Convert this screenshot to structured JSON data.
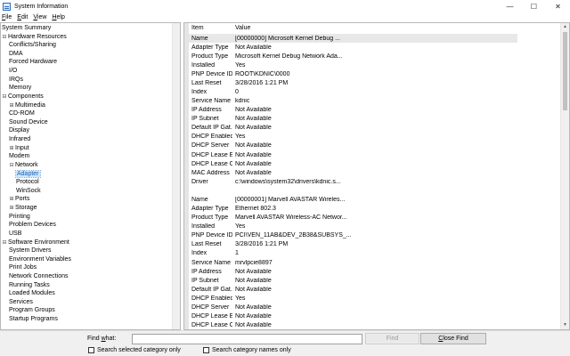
{
  "window": {
    "title": "System Information"
  },
  "controls": {
    "minimize": "—",
    "maximize": "☐",
    "close": "✕"
  },
  "menu": [
    {
      "label_pre": "",
      "label_u": "F",
      "label_post": "ile"
    },
    {
      "label_pre": "",
      "label_u": "E",
      "label_post": "dit"
    },
    {
      "label_pre": "",
      "label_u": "V",
      "label_post": "iew"
    },
    {
      "label_pre": "",
      "label_u": "H",
      "label_post": "elp"
    }
  ],
  "tree": [
    {
      "label": "System Summary",
      "level": 0,
      "expander": ""
    },
    {
      "label": "Hardware Resources",
      "level": 0,
      "expander": "⊟"
    },
    {
      "label": "Conflicts/Sharing",
      "level": 1,
      "expander": ""
    },
    {
      "label": "DMA",
      "level": 1,
      "expander": ""
    },
    {
      "label": "Forced Hardware",
      "level": 1,
      "expander": ""
    },
    {
      "label": "I/O",
      "level": 1,
      "expander": ""
    },
    {
      "label": "IRQs",
      "level": 1,
      "expander": ""
    },
    {
      "label": "Memory",
      "level": 1,
      "expander": ""
    },
    {
      "label": "Components",
      "level": 0,
      "expander": "⊟"
    },
    {
      "label": "Multimedia",
      "level": 1,
      "expander": "⊞"
    },
    {
      "label": "CD-ROM",
      "level": 1,
      "expander": ""
    },
    {
      "label": "Sound Device",
      "level": 1,
      "expander": ""
    },
    {
      "label": "Display",
      "level": 1,
      "expander": ""
    },
    {
      "label": "Infrared",
      "level": 1,
      "expander": ""
    },
    {
      "label": "Input",
      "level": 1,
      "expander": "⊞"
    },
    {
      "label": "Modem",
      "level": 1,
      "expander": ""
    },
    {
      "label": "Network",
      "level": 1,
      "expander": "⊟"
    },
    {
      "label": "Adapter",
      "level": 2,
      "expander": "",
      "selected": true
    },
    {
      "label": "Protocol",
      "level": 2,
      "expander": ""
    },
    {
      "label": "WinSock",
      "level": 2,
      "expander": ""
    },
    {
      "label": "Ports",
      "level": 1,
      "expander": "⊞"
    },
    {
      "label": "Storage",
      "level": 1,
      "expander": "⊞"
    },
    {
      "label": "Printing",
      "level": 1,
      "expander": ""
    },
    {
      "label": "Problem Devices",
      "level": 1,
      "expander": ""
    },
    {
      "label": "USB",
      "level": 1,
      "expander": ""
    },
    {
      "label": "Software Environment",
      "level": 0,
      "expander": "⊟"
    },
    {
      "label": "System Drivers",
      "level": 1,
      "expander": ""
    },
    {
      "label": "Environment Variables",
      "level": 1,
      "expander": ""
    },
    {
      "label": "Print Jobs",
      "level": 1,
      "expander": ""
    },
    {
      "label": "Network Connections",
      "level": 1,
      "expander": ""
    },
    {
      "label": "Running Tasks",
      "level": 1,
      "expander": ""
    },
    {
      "label": "Loaded Modules",
      "level": 1,
      "expander": ""
    },
    {
      "label": "Services",
      "level": 1,
      "expander": ""
    },
    {
      "label": "Program Groups",
      "level": 1,
      "expander": ""
    },
    {
      "label": "Startup Programs",
      "level": 1,
      "expander": ""
    }
  ],
  "table": {
    "headers": {
      "item": "Item",
      "value": "Value"
    },
    "rows": [
      {
        "item": "Name",
        "value": "[00000000] Microsoft Kernel Debug ...",
        "selected": true
      },
      {
        "item": "Adapter Type",
        "value": "Not Available"
      },
      {
        "item": "Product Type",
        "value": "Microsoft Kernel Debug Network Ada..."
      },
      {
        "item": "Installed",
        "value": "Yes"
      },
      {
        "item": "PNP Device ID",
        "value": "ROOT\\KDNIC\\0000"
      },
      {
        "item": "Last Reset",
        "value": "3/28/2016 1:21 PM"
      },
      {
        "item": "Index",
        "value": "0"
      },
      {
        "item": "Service Name",
        "value": "kdnic"
      },
      {
        "item": "IP Address",
        "value": "Not Available"
      },
      {
        "item": "IP Subnet",
        "value": "Not Available"
      },
      {
        "item": "Default IP Gat...",
        "value": "Not Available"
      },
      {
        "item": "DHCP Enabled",
        "value": "Yes"
      },
      {
        "item": "DHCP Server",
        "value": "Not Available"
      },
      {
        "item": "DHCP Lease E...",
        "value": "Not Available"
      },
      {
        "item": "DHCP Lease O...",
        "value": "Not Available"
      },
      {
        "item": "MAC Address",
        "value": "Not Available"
      },
      {
        "item": "Driver",
        "value": "c:\\windows\\system32\\drivers\\kdnic.s..."
      },
      {
        "item": "",
        "value": ""
      },
      {
        "item": "Name",
        "value": "[00000001] Marvell AVASTAR Wireles..."
      },
      {
        "item": "Adapter Type",
        "value": "Ethernet 802.3"
      },
      {
        "item": "Product Type",
        "value": "Marvell AVASTAR Wireless-AC Networ..."
      },
      {
        "item": "Installed",
        "value": "Yes"
      },
      {
        "item": "PNP Device ID",
        "value": "PCI\\VEN_11AB&DEV_2B38&SUBSYS_..."
      },
      {
        "item": "Last Reset",
        "value": "3/28/2016 1:21 PM"
      },
      {
        "item": "Index",
        "value": "1"
      },
      {
        "item": "Service Name",
        "value": "mrvlpcie8897"
      },
      {
        "item": "IP Address",
        "value": "Not Available"
      },
      {
        "item": "IP Subnet",
        "value": "Not Available"
      },
      {
        "item": "Default IP Gat...",
        "value": "Not Available"
      },
      {
        "item": "DHCP Enabled",
        "value": "Yes"
      },
      {
        "item": "DHCP Server",
        "value": "Not Available"
      },
      {
        "item": "DHCP Lease E...",
        "value": "Not Available"
      },
      {
        "item": "DHCP Lease O...",
        "value": "Not Available"
      }
    ]
  },
  "find": {
    "label_pre": "Find ",
    "label_u": "w",
    "label_post": "hat:",
    "input_value": "",
    "find_button": "Find",
    "close_button_u": "C",
    "close_button_post": "lose Find",
    "search_selected_label": "Search selected category only",
    "search_names_label": "Search category names only"
  }
}
